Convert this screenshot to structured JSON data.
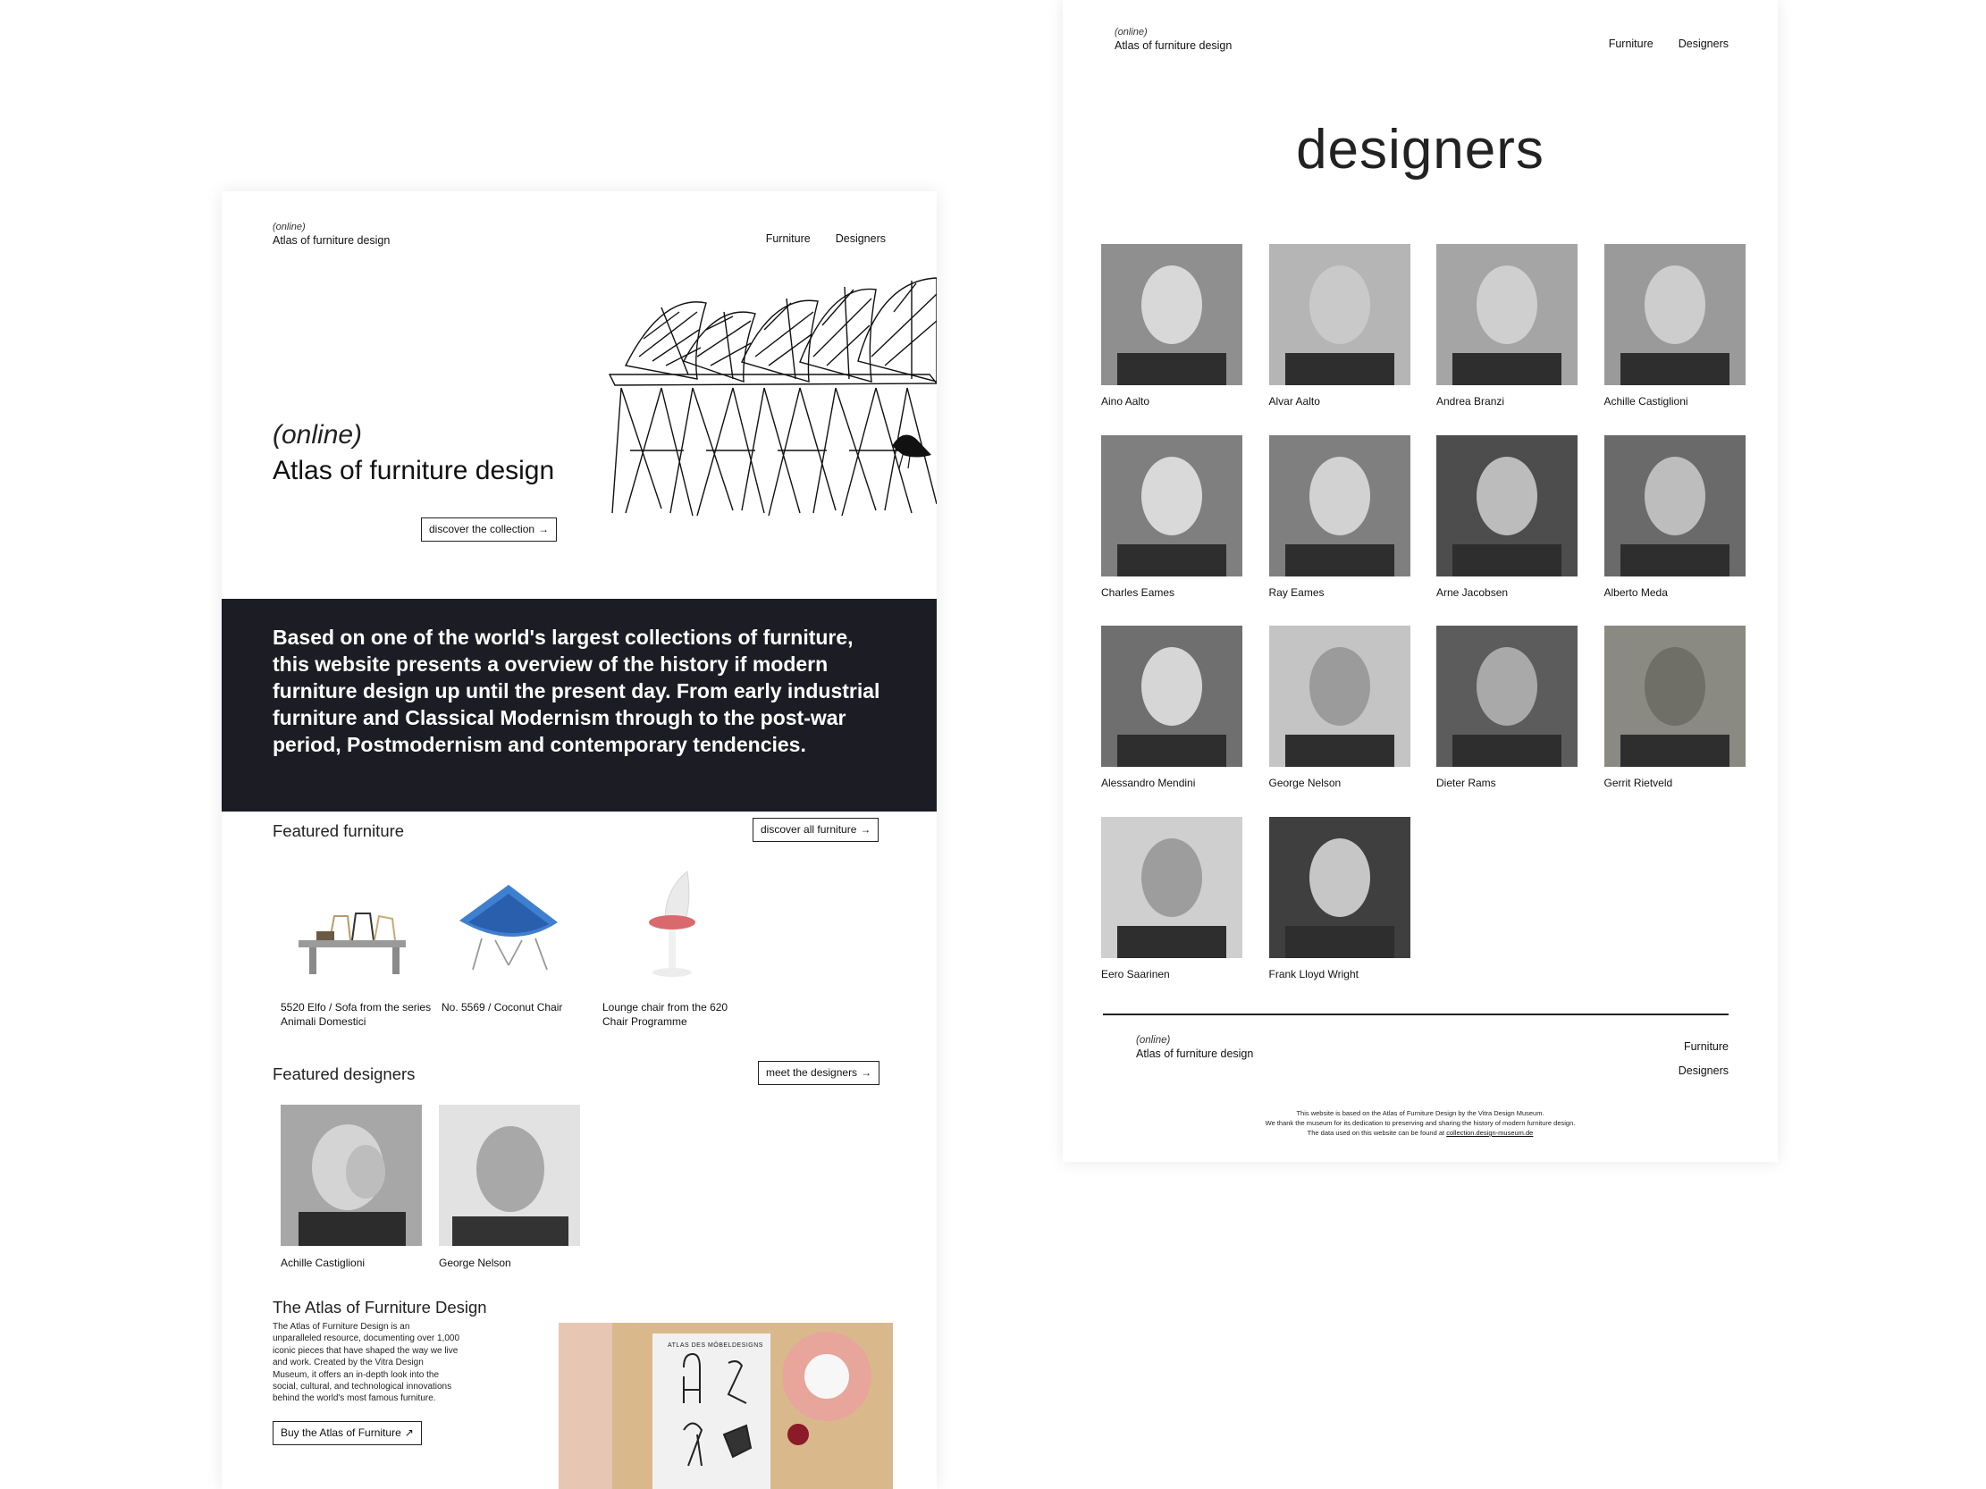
{
  "home": {
    "header": {
      "online": "(online)",
      "brand": "Atlas of furniture design",
      "nav": [
        "Furniture",
        "Designers"
      ]
    },
    "hero": {
      "online": "(online)",
      "title": "Atlas of furniture design",
      "cta": "discover the collection",
      "image_icon": "wire-chairs-illustration"
    },
    "banner_text": "Based on one of the world's largest collections of furniture, this website presents a overview of the history if modern furniture design up until the present day. From early industrial furniture and Classical Modernism through to the post-war period, Postmodernism and contemporary tendencies.",
    "featured_furniture": {
      "title": "Featured furniture",
      "cta": "discover all furniture",
      "items": [
        {
          "caption": "5520 Elfo / Sofa from the series Animali Domestici"
        },
        {
          "caption": "No. 5569 / Coconut Chair"
        },
        {
          "caption": "Lounge chair from the 620 Chair Programme"
        }
      ]
    },
    "featured_designers": {
      "title": "Featured designers",
      "cta": "meet the designers",
      "items": [
        {
          "name": "Achille Castiglioni"
        },
        {
          "name": "George Nelson"
        }
      ]
    },
    "atlas": {
      "title": "The Atlas of Furniture Design",
      "text": "The Atlas of Furniture Design is an unparalleled resource, documenting over 1,000 iconic pieces that have shaped the way we live and work. Created by the Vitra Design Museum, it offers an in-depth look into the social, cultural, and technological innovations behind the world's most famous furniture.",
      "cta": "Buy the Atlas of Furniture",
      "book_title": "ATLAS DES MÖBELDESIGNS"
    }
  },
  "designers_page": {
    "header": {
      "online": "(online)",
      "brand": "Atlas of furniture design",
      "nav": [
        "Furniture",
        "Designers"
      ]
    },
    "title": "designers",
    "designers": [
      "Aino Aalto",
      "Alvar Aalto",
      "Andrea Branzi",
      "Achille Castiglioni",
      "Charles Eames",
      "Ray Eames",
      "Arne Jacobsen",
      "Alberto Meda",
      "Alessandro Mendini",
      "George Nelson",
      "Dieter Rams",
      "Gerrit Rietveld",
      "Eero Saarinen",
      "Frank Lloyd Wright"
    ],
    "footer": {
      "online": "(online)",
      "brand": "Atlas of furniture design",
      "nav": [
        "Furniture",
        "Designers"
      ],
      "note_line1": "This website is based on the Atlas of Furniture Design by the Vitra Design Museum.",
      "note_line2": "We thank the museum for its dedication to preserving and sharing the history of modern furniture design.",
      "note_line3": "The data used on this website can be found at",
      "note_link": "collection.design-museum.de"
    }
  },
  "colors": {
    "banner": "#1c1d24",
    "text": "#1b1b1f",
    "background": "#ffffff"
  }
}
